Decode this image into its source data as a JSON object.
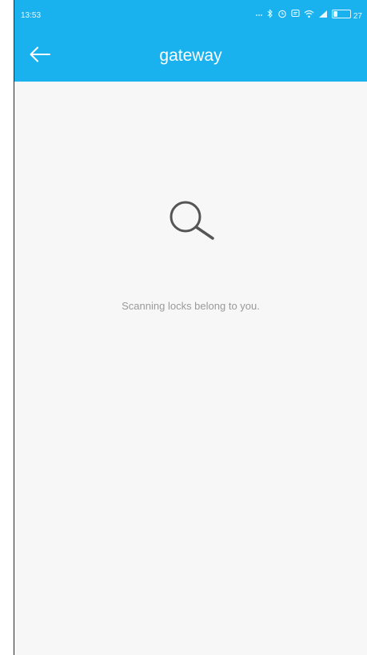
{
  "status_bar": {
    "time": "13:53",
    "battery_level": 0.27,
    "battery_label": "27",
    "icons": [
      "dots-icon",
      "bluetooth-icon",
      "alarm-icon",
      "message-icon",
      "wifi-icon",
      "signal-icon",
      "battery-icon"
    ]
  },
  "toolbar": {
    "title": "gateway",
    "back_icon": "arrow-left-icon",
    "background": "#1ab2ee"
  },
  "content": {
    "icon": "search-icon",
    "message": "Scanning locks belong to you."
  }
}
